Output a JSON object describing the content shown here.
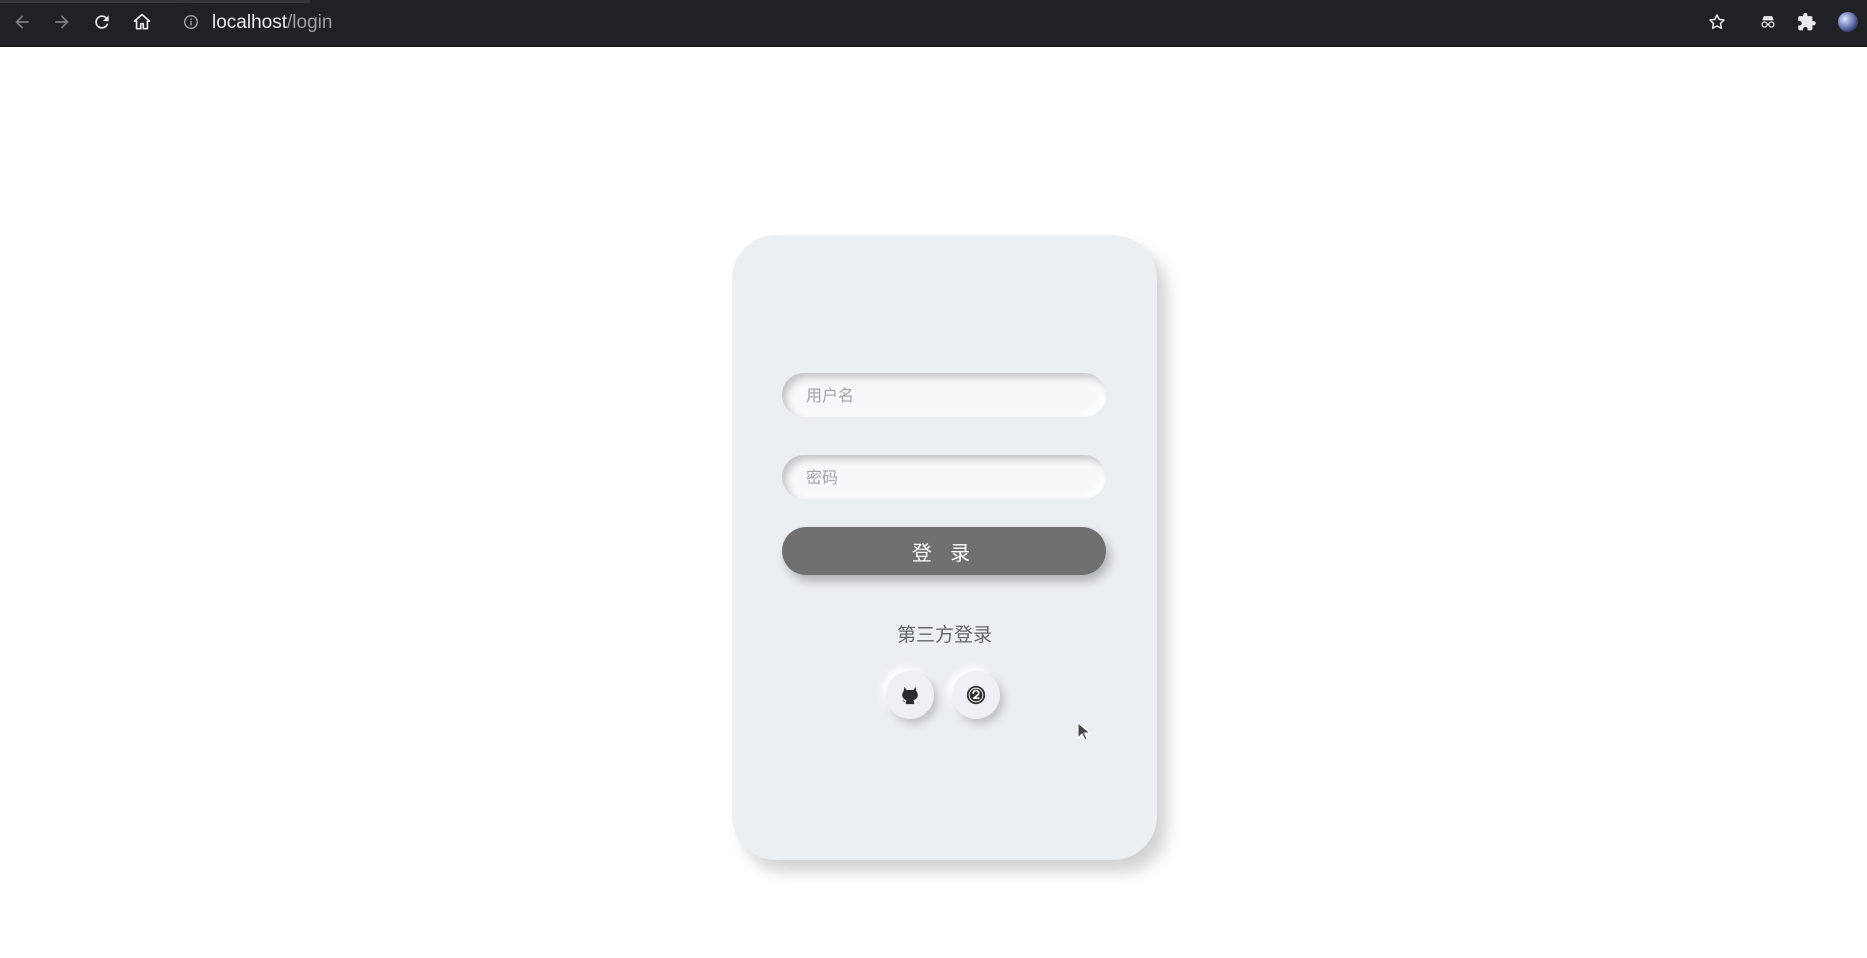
{
  "browser": {
    "url_host": "localhost",
    "url_path": "/login",
    "nav_icons": [
      "back-arrow-icon",
      "forward-arrow-icon",
      "reload-icon",
      "home-icon",
      "site-info-icon"
    ],
    "right_icons": [
      "bookmark-star-icon",
      "incognito-extension-icon",
      "extensions-puzzle-icon",
      "profile-avatar-icon"
    ]
  },
  "login": {
    "username_placeholder": "用户名",
    "password_placeholder": "密码",
    "submit_label": "登 录",
    "third_party_title": "第三方登录",
    "third_party_providers": [
      "github-icon",
      "other-provider-icon"
    ]
  },
  "colors": {
    "toolbar_bg": "#202124",
    "card_bg": "#ebeef2",
    "button_bg": "#707070",
    "page_bg": "#ffffff"
  }
}
